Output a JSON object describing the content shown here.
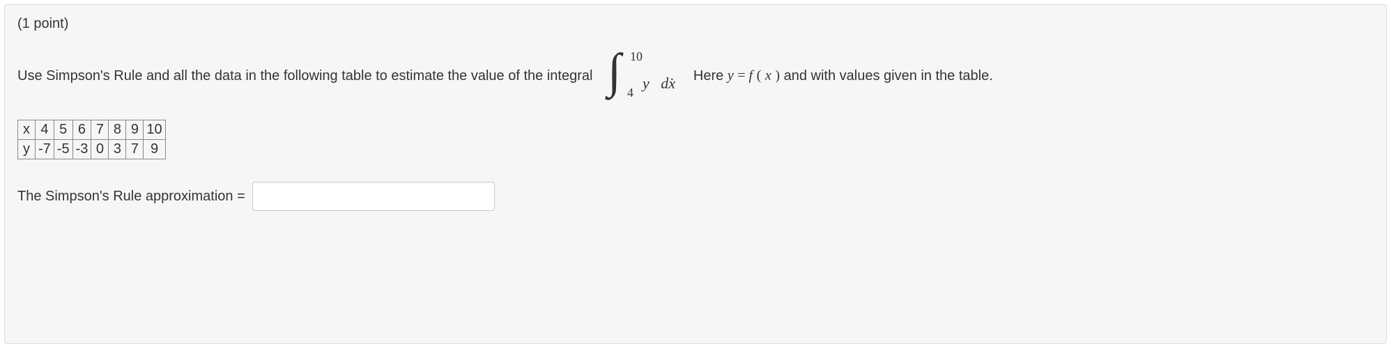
{
  "problem": {
    "points_label": "(1 point)",
    "instruction_pre": "Use Simpson's Rule and all the data in the following table to estimate the value of the integral ",
    "integral": {
      "lower": "4",
      "upper": "10",
      "integrand_var": "y",
      "differential": "dx"
    },
    "instruction_post_period": ".",
    "instruction_post1": "Here ",
    "equation_lhs": "y",
    "equation_eq": " = ",
    "equation_rhs_f": "f",
    "equation_rhs_paren_open": "(",
    "equation_rhs_x": "x",
    "equation_rhs_paren_close": ")",
    "instruction_post2": " and with values given in the table.",
    "table": {
      "row_labels": [
        "x",
        "y"
      ],
      "x": [
        "4",
        "5",
        "6",
        "7",
        "8",
        "9",
        "10"
      ],
      "y": [
        "-7",
        "-5",
        "-3",
        "0",
        "3",
        "7",
        "9"
      ]
    },
    "answer_label": "The Simpson's Rule approximation =",
    "answer_value": ""
  }
}
